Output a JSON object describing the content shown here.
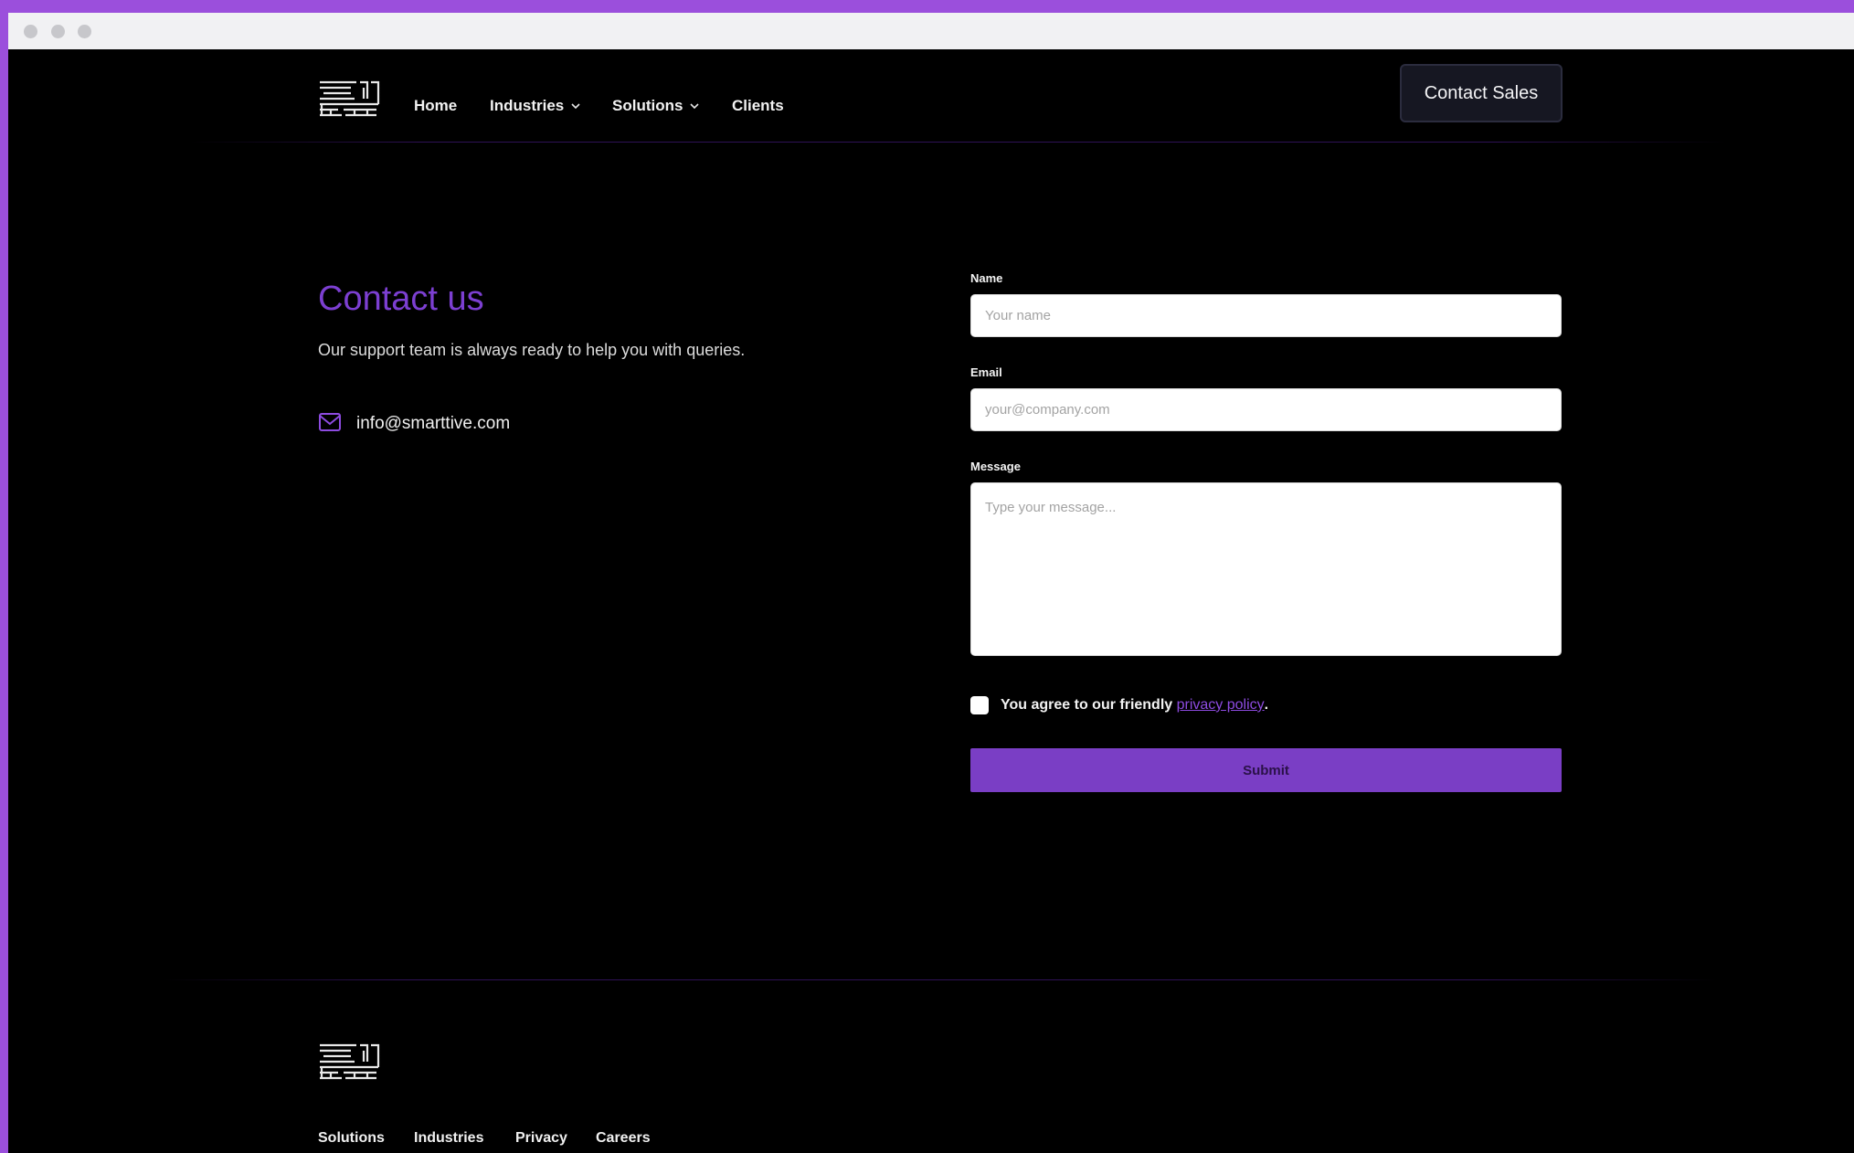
{
  "header": {
    "logo": "brand-logo",
    "nav": [
      {
        "label": "Home",
        "has_dropdown": false
      },
      {
        "label": "Industries",
        "has_dropdown": true
      },
      {
        "label": "Solutions",
        "has_dropdown": true
      },
      {
        "label": "Clients",
        "has_dropdown": false
      }
    ],
    "cta_label": "Contact Sales"
  },
  "contact": {
    "title": "Contact us",
    "subtitle": "Our support team is always ready to help you with queries.",
    "email_icon": "mail-icon",
    "email": "info@smarttive.com"
  },
  "form": {
    "name_label": "Name",
    "name_placeholder": "Your name",
    "email_label": "Email",
    "email_placeholder": "your@company.com",
    "message_label": "Message",
    "message_placeholder": "Type your message...",
    "consent_prefix": "You agree to our friendly ",
    "consent_link": "privacy policy",
    "consent_suffix": ".",
    "submit_label": "Submit"
  },
  "footer": {
    "logo": "brand-logo",
    "links": [
      "Solutions",
      "Industries",
      "Privacy",
      "Careers"
    ]
  },
  "colors": {
    "accent": "#7c3fd1",
    "background": "#000000",
    "frame": "#9b4fdc"
  }
}
